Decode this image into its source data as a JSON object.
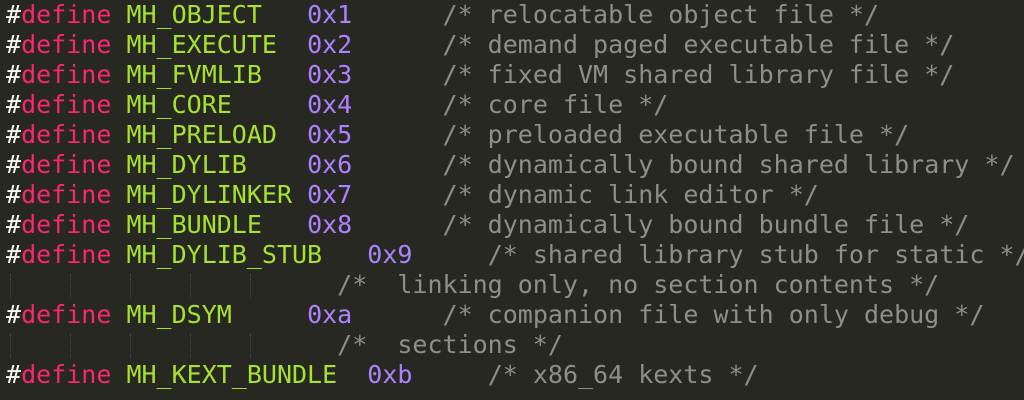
{
  "editor": {
    "colors": {
      "background": "#272822",
      "hash": "#f8f8f2",
      "keyword": "#f92672",
      "macro": "#a6e22e",
      "number": "#ae81ff",
      "comment": "#8f8f87"
    },
    "lines": [
      {
        "hash": "#",
        "kw": "define",
        "macro": "MH_OBJECT",
        "pad1": "   ",
        "value": "0x1",
        "pad2": "      ",
        "comment": "/* relocatable object file */"
      },
      {
        "hash": "#",
        "kw": "define",
        "macro": "MH_EXECUTE",
        "pad1": "  ",
        "value": "0x2",
        "pad2": "      ",
        "comment": "/* demand paged executable file */"
      },
      {
        "hash": "#",
        "kw": "define",
        "macro": "MH_FVMLIB",
        "pad1": "   ",
        "value": "0x3",
        "pad2": "      ",
        "comment": "/* fixed VM shared library file */"
      },
      {
        "hash": "#",
        "kw": "define",
        "macro": "MH_CORE",
        "pad1": "     ",
        "value": "0x4",
        "pad2": "      ",
        "comment": "/* core file */"
      },
      {
        "hash": "#",
        "kw": "define",
        "macro": "MH_PRELOAD",
        "pad1": "  ",
        "value": "0x5",
        "pad2": "      ",
        "comment": "/* preloaded executable file */"
      },
      {
        "hash": "#",
        "kw": "define",
        "macro": "MH_DYLIB",
        "pad1": "    ",
        "value": "0x6",
        "pad2": "      ",
        "comment": "/* dynamically bound shared library */"
      },
      {
        "hash": "#",
        "kw": "define",
        "macro": "MH_DYLINKER",
        "pad1": " ",
        "value": "0x7",
        "pad2": "      ",
        "comment": "/* dynamic link editor */"
      },
      {
        "hash": "#",
        "kw": "define",
        "macro": "MH_BUNDLE",
        "pad1": "   ",
        "value": "0x8",
        "pad2": "      ",
        "comment": "/* dynamically bound bundle file */"
      },
      {
        "hash": "#",
        "kw": "define",
        "macro": "MH_DYLIB_STUB",
        "pad1": "   ",
        "value": "0x9",
        "pad2": "     ",
        "comment": "/* shared library stub for static */"
      },
      {
        "hash": "",
        "kw": "",
        "macro": "",
        "pad1": "                      ",
        "value": "",
        "pad2": "",
        "comment": "/*  linking only, no section contents */"
      },
      {
        "hash": "#",
        "kw": "define",
        "macro": "MH_DSYM",
        "pad1": "     ",
        "value": "0xa",
        "pad2": "      ",
        "comment": "/* companion file with only debug */"
      },
      {
        "hash": "",
        "kw": "",
        "macro": "",
        "pad1": "                      ",
        "value": "",
        "pad2": "",
        "comment": "/*  sections */"
      },
      {
        "hash": "#",
        "kw": "define",
        "macro": "MH_KEXT_BUNDLE",
        "pad1": "  ",
        "value": "0xb",
        "pad2": "     ",
        "comment": "/* x86_64 kexts */"
      }
    ]
  }
}
